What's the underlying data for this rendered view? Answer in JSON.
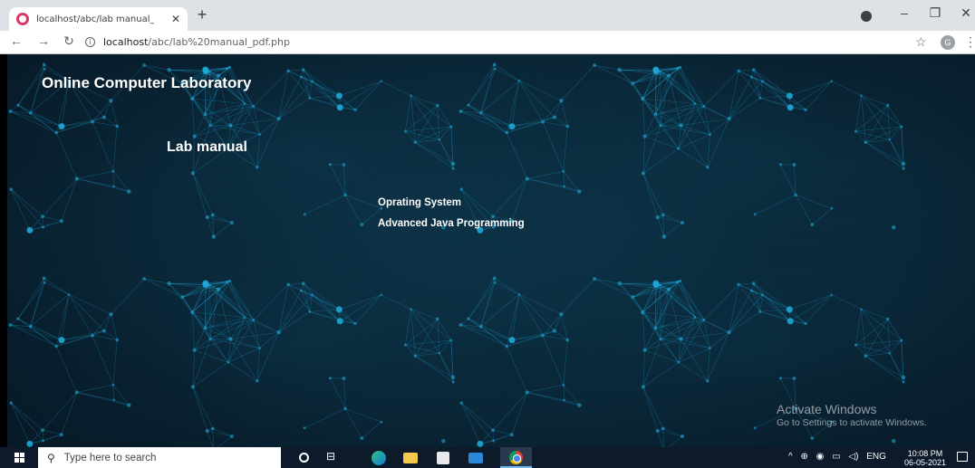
{
  "browser": {
    "tab_title": "localhost/abc/lab manual_pdf.ph",
    "tab_close": "✕",
    "new_tab": "+",
    "url_host": "localhost",
    "url_path": "/abc/lab%20manual_pdf.php",
    "account_initial": "G",
    "window_controls": {
      "minimize": "–",
      "restore": "❐",
      "close": "✕"
    }
  },
  "page": {
    "site_title": "Online Computer Laboratory",
    "heading": "Lab manual",
    "manuals": [
      {
        "label": "Oprating System"
      },
      {
        "label": "Advanced Java Programming"
      }
    ],
    "watermark": {
      "title": "Activate Windows",
      "subtitle": "Go to Settings to activate Windows."
    }
  },
  "taskbar": {
    "search_placeholder": "Type here to search",
    "language": "ENG",
    "time": "10:08 PM",
    "date": "06-05-2021"
  },
  "colors": {
    "page_background": "#06121e",
    "network_node": "#1ea7d6",
    "taskbar": "#0c1a2a"
  }
}
